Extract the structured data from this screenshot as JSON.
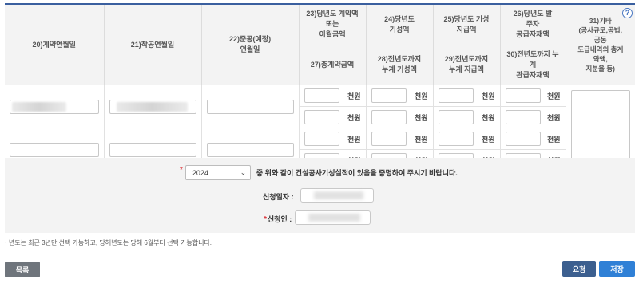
{
  "table": {
    "headers": {
      "contract_date": "20)계약연월일",
      "start_date": "21)착공연월일",
      "completion_date": "22)준공(예정)\n연월일",
      "contract_amount": "23)당년도 계약액\n또는\n이월금액",
      "total_contract": "27)총계약금액",
      "performance": "24)당년도\n기성액",
      "prev_performance": "28)전년도까지\n누계 기성액",
      "payment": "25)당년도 기성\n지급액",
      "prev_payment": "29)전년도까지\n누계 지급액",
      "order_payment": "26)당년도 발\n주자\n공급자재액",
      "prev_order_payment": "30)전년도까지 누\n계\n관급자재액",
      "etc": "31)기타\n(공사규모,공법,\n공동\n도급내역의 총계\n약액,\n지분율 등)"
    },
    "unit": "천원",
    "help_icon": "?"
  },
  "form": {
    "year_value": "2024",
    "certify_text": "중 위와 같이 건설공사기성실적이 있음을 증명하여 주시기 바랍니다.",
    "apply_date_label": "신청일자 :",
    "applicant_label": "신청인 :",
    "required_mark": "*"
  },
  "note": "· 년도는 최근 3년만 선택 가능하고, 당해년도는 당해 6월부터 선택 가능합니다.",
  "buttons": {
    "list": "목록",
    "request": "요청",
    "save": "저장"
  },
  "colors": {
    "accent": "#3a5f9f",
    "save": "#2f80d6",
    "request": "#3c5f8f",
    "list": "#6f757c",
    "required": "#d9262c"
  }
}
